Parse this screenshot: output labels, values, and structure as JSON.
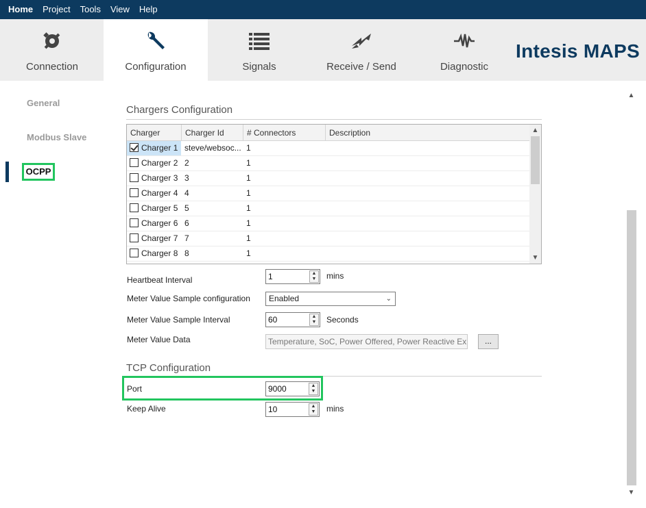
{
  "menubar": {
    "items": [
      "Home",
      "Project",
      "Tools",
      "View",
      "Help"
    ]
  },
  "tabs": [
    {
      "label": "Connection",
      "icon": "plug-icon"
    },
    {
      "label": "Configuration",
      "icon": "wrench-icon"
    },
    {
      "label": "Signals",
      "icon": "list-icon"
    },
    {
      "label": "Receive / Send",
      "icon": "transfer-arrows-icon"
    },
    {
      "label": "Diagnostic",
      "icon": "pulse-icon"
    }
  ],
  "brand": "Intesis MAPS",
  "sidebar": {
    "items": [
      "General",
      "Modbus Slave",
      "OCPP"
    ],
    "active": "OCPP"
  },
  "chargers": {
    "title": "Chargers Configuration",
    "columns": [
      "Charger",
      "Charger Id",
      "# Connectors",
      "Description"
    ],
    "rows": [
      {
        "name": "Charger 1",
        "id": "steve/websoc...",
        "connectors": "1",
        "description": "",
        "checked": true
      },
      {
        "name": "Charger 2",
        "id": "2",
        "connectors": "1",
        "description": "",
        "checked": false
      },
      {
        "name": "Charger 3",
        "id": "3",
        "connectors": "1",
        "description": "",
        "checked": false
      },
      {
        "name": "Charger 4",
        "id": "4",
        "connectors": "1",
        "description": "",
        "checked": false
      },
      {
        "name": "Charger 5",
        "id": "5",
        "connectors": "1",
        "description": "",
        "checked": false
      },
      {
        "name": "Charger 6",
        "id": "6",
        "connectors": "1",
        "description": "",
        "checked": false
      },
      {
        "name": "Charger 7",
        "id": "7",
        "connectors": "1",
        "description": "",
        "checked": false
      },
      {
        "name": "Charger 8",
        "id": "8",
        "connectors": "1",
        "description": "",
        "checked": false
      }
    ]
  },
  "settings": {
    "heartbeat": {
      "label": "Heartbeat Interval",
      "value": "1",
      "unit": "mins"
    },
    "meter_config": {
      "label": "Meter Value Sample configuration",
      "value": "Enabled"
    },
    "meter_interval": {
      "label": "Meter Value Sample Interval",
      "value": "60",
      "unit": "Seconds"
    },
    "meter_data": {
      "label": "Meter Value Data",
      "value": "Temperature, SoC, Power Offered, Power Reactive Expo",
      "button": "..."
    }
  },
  "tcp": {
    "title": "TCP Configuration",
    "port": {
      "label": "Port",
      "value": "9000"
    },
    "keep_alive": {
      "label": "Keep Alive",
      "value": "10",
      "unit": "mins"
    }
  },
  "colors": {
    "brand": "#0d3a5f",
    "highlight": "#22c55e",
    "selection": "#cce4f7"
  }
}
